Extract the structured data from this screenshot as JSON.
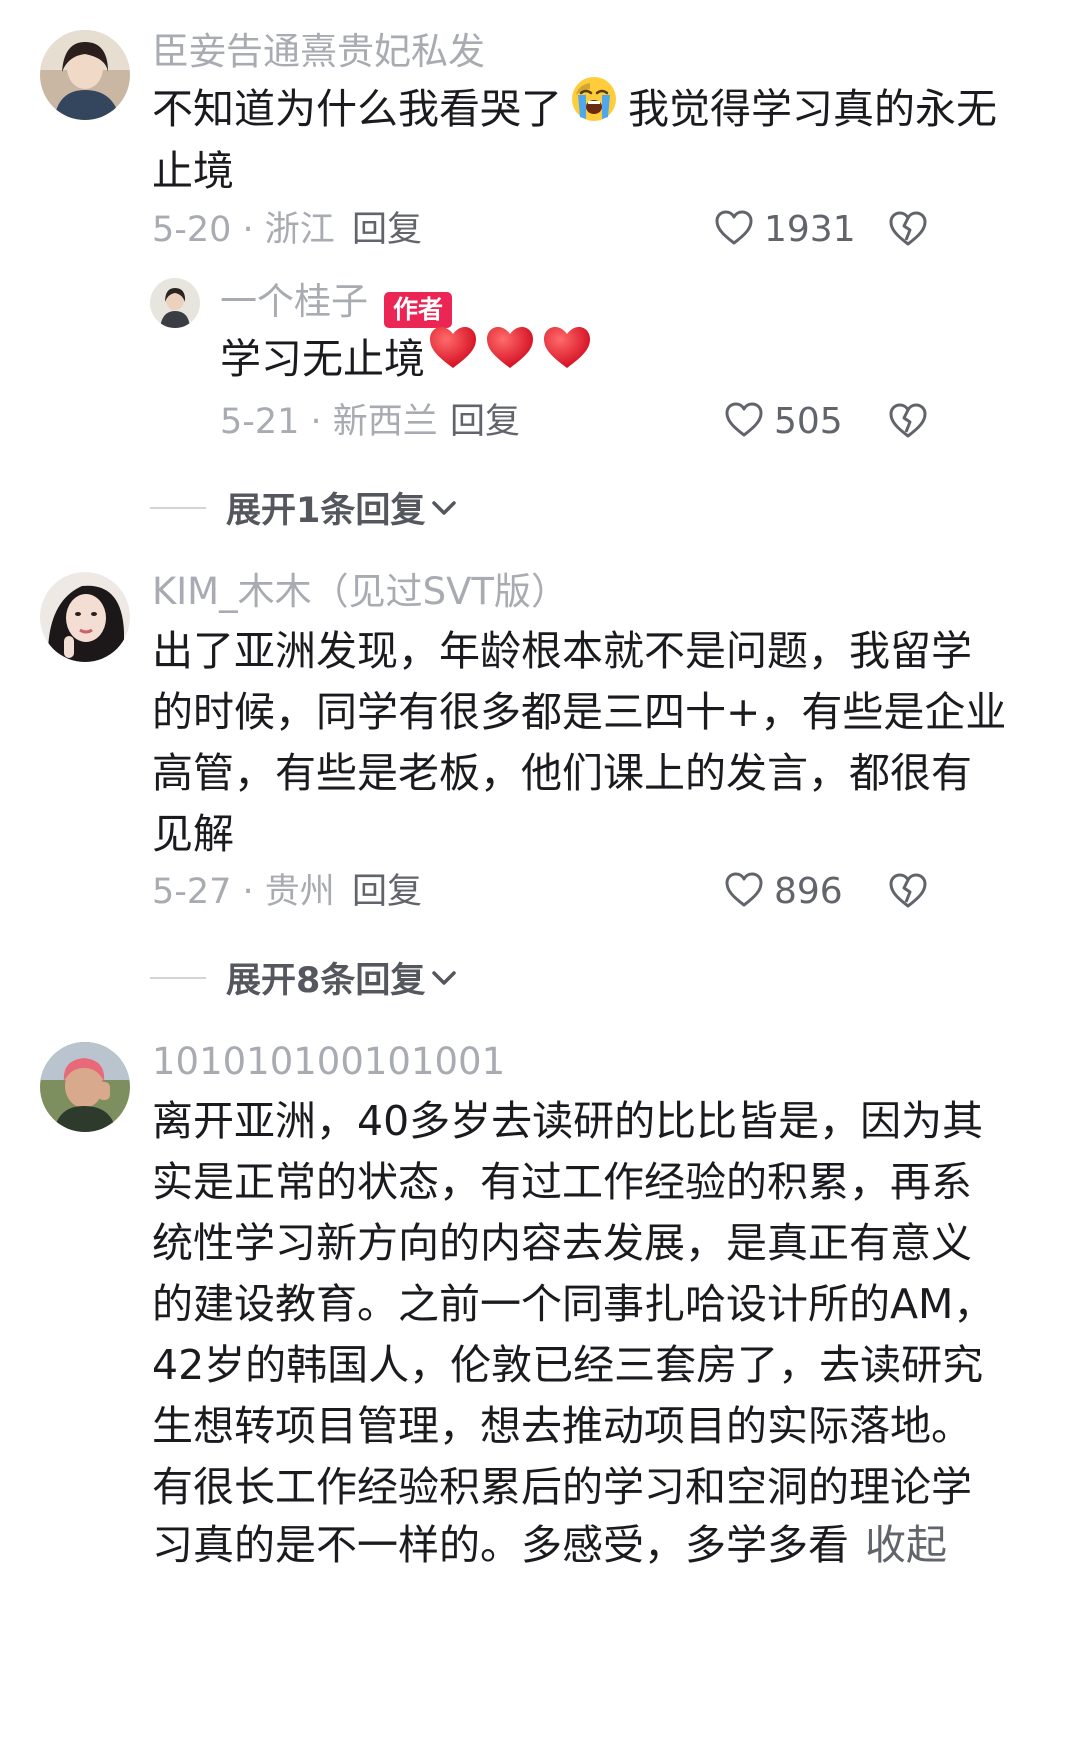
{
  "comments": [
    {
      "username": "臣妾告通熹贵妃私发",
      "text_a": "不知道为什么我看哭了",
      "emoji": "loudly-crying-face",
      "text_b": "我觉得学习真的永无",
      "text_c": "止境",
      "meta": "5-20 · 浙江",
      "reply_label": "回复",
      "likes": "1931",
      "replies": [
        {
          "username": "一个桂子",
          "badge": "作者",
          "text": "学习无止境",
          "emoji": "red-heart x3",
          "meta": "5-21 · 新西兰",
          "reply_label": "回复",
          "likes": "505"
        }
      ],
      "expand_label": "展开1条回复"
    },
    {
      "username": "KIM_木木（见过SVT版）",
      "lines": [
        "出了亚洲发现，年龄根本就不是问题，我留学",
        "的时候，同学有很多都是三四十+，有些是企业",
        "高管，有些是老板，他们课上的发言，都很有",
        "见解"
      ],
      "meta": "5-27 · 贵州",
      "reply_label": "回复",
      "likes": "896",
      "expand_label": "展开8条回复"
    },
    {
      "username": "101010100101001",
      "lines": [
        "离开亚洲，40多岁去读研的比比皆是，因为其",
        "实是正常的状态，有过工作经验的积累，再系",
        "统性学习新方向的内容去发展，是真正有意义",
        "的建设教育。之前一个同事扎哈设计所的AM，",
        "42岁的韩国人，伦敦已经三套房了，去读研究",
        "生想转项目管理，想去推动项目的实际落地。",
        "有很长工作经验积累后的学习和空洞的理论学",
        "习真的是不一样的。多感受，多学多看"
      ],
      "collapse_label": "收起"
    }
  ],
  "colors": {
    "text": "#1b1b1f",
    "secondary": "#a9abb3",
    "action": "#62646c",
    "badge": "#ec2654",
    "heart_emoji": "#e8182f"
  }
}
